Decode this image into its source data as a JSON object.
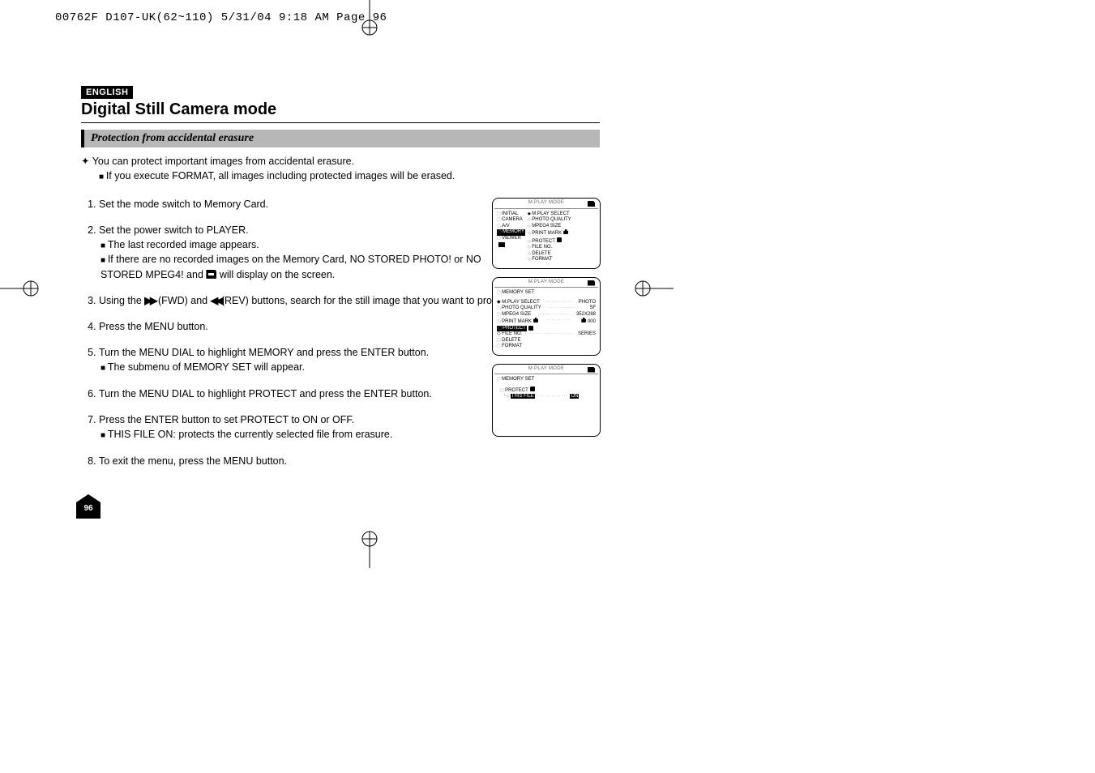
{
  "print": {
    "header": "00762F D107-UK(62~110)  5/31/04 9:18 AM  Page 96"
  },
  "lang": "ENGLISH",
  "title": "Digital Still Camera mode",
  "section": "Protection from accidental erasure",
  "intro": {
    "line1": "You can protect important images from accidental erasure.",
    "sub1": "If you execute FORMAT, all images including protected images will be erased."
  },
  "steps": [
    {
      "text": "Set the mode switch to Memory Card."
    },
    {
      "text": "Set the power switch to PLAYER.",
      "subs": [
        "The last recorded image appears.",
        "If there are no recorded images on the Memory Card, NO STORED PHOTO! or NO STORED MPEG4! and  will display on the screen."
      ],
      "icon_after_and": true
    },
    {
      "text_pre": "Using the ",
      "fwd": "▶▶",
      "mid1": " (FWD) and  ",
      "rev": "◀◀",
      "mid2": "(REV) buttons, search for the still image that you want to protect."
    },
    {
      "text": "Press the MENU button."
    },
    {
      "text": "Turn the MENU DIAL to highlight MEMORY and press the ENTER button.",
      "subs": [
        "The submenu of MEMORY SET will appear."
      ]
    },
    {
      "text": "Turn the MENU DIAL to highlight PROTECT and press the ENTER button."
    },
    {
      "text": "Press the ENTER button to set PROTECT to ON or OFF.",
      "subs": [
        "THIS FILE ON: protects the currently selected file from erasure."
      ]
    },
    {
      "text": "To exit the menu, press the MENU button."
    }
  ],
  "page_number": "96",
  "mock": {
    "title": "M.PLAY  MODE",
    "p1_left": [
      "INITIAL",
      "CAMERA",
      "A/V",
      "MEMORY",
      "VIEWER"
    ],
    "p1_right": [
      "M.PLAY SELECT",
      "PHOTO QUALITY",
      "MPEG4 SIZE",
      "PRINT MARK",
      "PROTECT",
      "FILE NO.",
      "DELETE",
      "FORMAT"
    ],
    "p2_head": "MEMORY SET",
    "p2_rows": [
      {
        "lab": "M.PLAY SELECT",
        "val": "PHOTO",
        "sel": true
      },
      {
        "lab": "PHOTO QUALITY",
        "val": "SF"
      },
      {
        "lab": "MPEG4 SIZE",
        "val": "352X288"
      },
      {
        "lab": "PRINT MARK",
        "val": "000",
        "mark": true
      },
      {
        "lab": "PROTECT",
        "val": "",
        "lock": true,
        "selrow": true
      },
      {
        "lab": "FILE NO.",
        "val": "SERIES"
      },
      {
        "lab": "DELETE",
        "val": ""
      },
      {
        "lab": "FORMAT",
        "val": ""
      }
    ],
    "p3_head": "MEMORY SET",
    "p3_protect": "PROTECT",
    "p3_file": "THIS FILE",
    "p3_val": "ON"
  }
}
